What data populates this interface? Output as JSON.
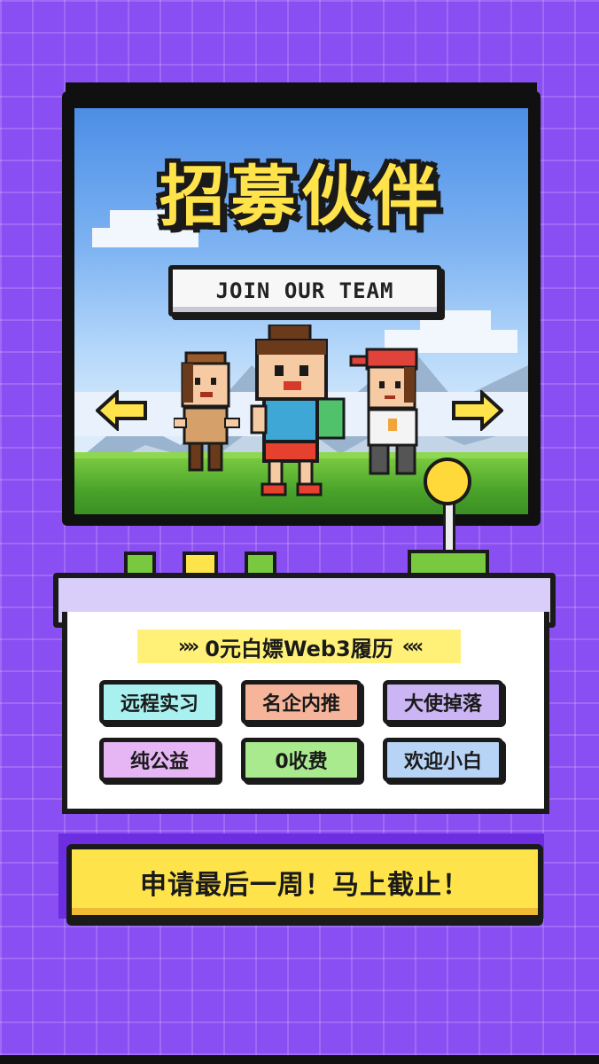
{
  "poster": {
    "title": "招募伙伴",
    "subtitle": "JOIN OUR TEAM",
    "headline": "0元白嫖Web3履历",
    "tags": [
      {
        "label": "远程实习",
        "color": "#a8f1f0"
      },
      {
        "label": "名企内推",
        "color": "#f6b59a"
      },
      {
        "label": "大使掉落",
        "color": "#cbb5f5"
      },
      {
        "label": "纯公益",
        "color": "#e5b5f4"
      },
      {
        "label": "0收费",
        "color": "#a9ea8e"
      },
      {
        "label": "欢迎小白",
        "color": "#b7d4f6"
      }
    ],
    "cta": "申请最后一周！马上截止！"
  },
  "colors": {
    "background": "#8a4ff2",
    "title_yellow": "#ffe34a",
    "grass": "#79c940"
  },
  "icons": [
    "arrow-left-icon",
    "arrow-right-icon",
    "joystick-icon"
  ]
}
